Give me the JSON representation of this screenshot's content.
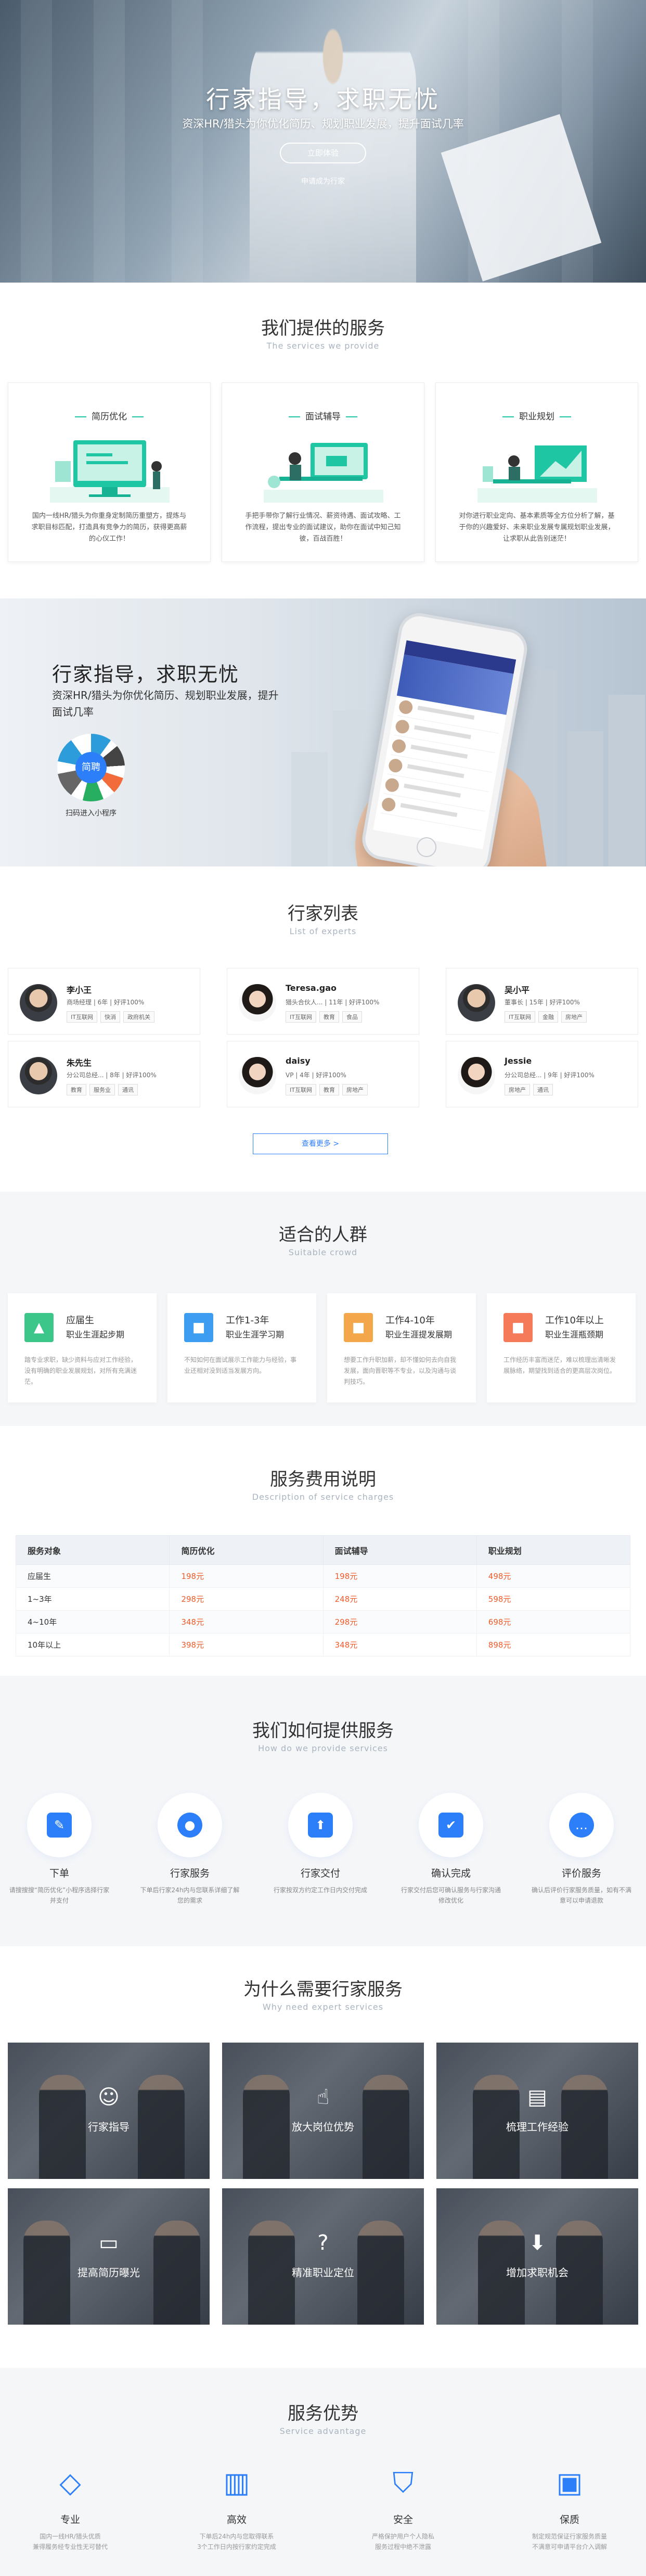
{
  "hero": {
    "title": "行家指导，求职无忧",
    "subtitle": "资深HR/猎头为你优化简历、规划职业发展，提升面试几率",
    "cta": "立即体验",
    "link": "申请成为行家"
  },
  "services": {
    "title": "我们提供的服务",
    "subtitle": "The services we provide",
    "items": [
      {
        "name": "简历优化",
        "desc": "国内一线HR/猎头为你重身定制简历重塑方，提炼与求职目标匹配，打造具有竞争力的简历，获得更高薪的心仪工作！",
        "icon": "resume-illustration"
      },
      {
        "name": "面试辅导",
        "desc": "手把手带你了解行业情况、薪资待遇、面试攻略、工作流程，提出专业的面试建议，助你在面试中知己知彼，百战百胜！",
        "icon": "interview-illustration"
      },
      {
        "name": "职业规划",
        "desc": "对你进行职业定向、基本素质等全方位分析了解，基于你的兴趣爱好、未来职业发展专属规划职业发展，让求职从此告别迷茫！",
        "icon": "career-illustration"
      }
    ]
  },
  "banner": {
    "title": "行家指导，求职无忧",
    "subtitle": "资深HR/猎头为你优化简历、规划职业发展，提升面试几率",
    "qr_center": "简聘",
    "qr_label": "扫码进入小程序"
  },
  "experts": {
    "title": "行家列表",
    "subtitle": "List of experts",
    "more": "查看更多 >",
    "items": [
      {
        "name": "李小王",
        "info": "商场经理 | 6年 | 好评100%",
        "tags": [
          "IT互联网",
          "快消",
          "政府机关"
        ],
        "gender": "m"
      },
      {
        "name": "Teresa.gao",
        "info": "猎头合伙人... | 11年 | 好评100%",
        "tags": [
          "IT互联网",
          "教育",
          "食品"
        ],
        "gender": "f"
      },
      {
        "name": "吴小平",
        "info": "董事长 | 15年 | 好评100%",
        "tags": [
          "IT互联网",
          "金融",
          "房地产"
        ],
        "gender": "m"
      },
      {
        "name": "朱先生",
        "info": "分公司总经... | 8年 | 好评100%",
        "tags": [
          "教育",
          "服务业",
          "通讯"
        ],
        "gender": "m"
      },
      {
        "name": "daisy",
        "info": "VP | 4年 | 好评100%",
        "tags": [
          "IT互联网",
          "教育",
          "房地产"
        ],
        "gender": "f"
      },
      {
        "name": "Jessie",
        "info": "分公司总经... | 9年 | 好评100%",
        "tags": [
          "房地产",
          "通讯"
        ],
        "gender": "f"
      }
    ]
  },
  "suitable": {
    "title": "适合的人群",
    "subtitle": "Suitable crowd",
    "items": [
      {
        "t1": "应届生",
        "t2": "职业生涯起步期",
        "desc": "踏专业求职，缺少资料与应对工作经验，没有明确的职业发展规划，对所有充满迷茫。",
        "color": "#3cc68a",
        "icon": "graduate-icon"
      },
      {
        "t1": "工作1-3年",
        "t2": "职业生涯学习期",
        "desc": "不知如何在面试展示工作能力与经验，事业还相对没到适当发展方向。",
        "color": "#3d9df0",
        "icon": "briefcase-icon"
      },
      {
        "t1": "工作4-10年",
        "t2": "职业生涯提发展期",
        "desc": "想要工作升职加薪，却不懂如何去向自我发展，面向晋职等不专业，以及沟通与谈判技巧。",
        "color": "#f4a74a",
        "icon": "briefcase-icon"
      },
      {
        "t1": "工作10年以上",
        "t2": "职业生涯瓶颈期",
        "desc": "工作经历丰富而迷茫，难以梳理出清晰发展脉络，期望找到适合的更高层次岗位。",
        "color": "#f57a5a",
        "icon": "briefcase-icon"
      }
    ]
  },
  "pricing": {
    "title": "服务费用说明",
    "subtitle": "Description of service charges",
    "headers": [
      "服务对象",
      "简历优化",
      "面试辅导",
      "职业规划"
    ],
    "rows": [
      [
        "应届生",
        "198元",
        "198元",
        "498元"
      ],
      [
        "1~3年",
        "298元",
        "248元",
        "598元"
      ],
      [
        "4~10年",
        "348元",
        "298元",
        "698元"
      ],
      [
        "10年以上",
        "398元",
        "348元",
        "898元"
      ]
    ]
  },
  "process": {
    "title": "我们如何提供服务",
    "subtitle": "How do we provide services",
    "items": [
      {
        "name": "下单",
        "desc": "请搜搜搜“简历优化”小程序选择行家并支付",
        "icon": "order-icon"
      },
      {
        "name": "行家服务",
        "desc": "下单后行家24h内与您联系详细了解您的需求",
        "icon": "user-icon"
      },
      {
        "name": "行家交付",
        "desc": "行家按双方约定工作日内交付完成",
        "icon": "upload-icon"
      },
      {
        "name": "确认完成",
        "desc": "行家交付后您可确认服务与行家沟通修改优化",
        "icon": "check-icon"
      },
      {
        "name": "评价服务",
        "desc": "确认后评价行家服务质量，如有不满意可以申请退款",
        "icon": "chat-icon"
      }
    ]
  },
  "why": {
    "title": "为什么需要行家服务",
    "subtitle": "Why need expert services",
    "items": [
      {
        "text": "行家指导",
        "icon": "user-icon"
      },
      {
        "text": "放大岗位优势",
        "icon": "thumb-icon"
      },
      {
        "text": "梳理工作经验",
        "icon": "document-icon"
      },
      {
        "text": "提高简历曝光",
        "icon": "monitor-icon"
      },
      {
        "text": "精准职业定位",
        "icon": "question-icon"
      },
      {
        "text": "增加求职机会",
        "icon": "download-icon"
      }
    ]
  },
  "advantage": {
    "title": "服务优势",
    "subtitle": "Service advantage",
    "items": [
      {
        "name": "专业",
        "desc": "国内一线HR/猎头优质\n兼得履务经专业性无可替代",
        "icon": "diamond-icon"
      },
      {
        "name": "高效",
        "desc": "下单后24h内与您取得联系\n3个工作日内按行家约定完成",
        "icon": "chart-icon"
      },
      {
        "name": "安全",
        "desc": "严格保护用户个人隐私\n服务过程中绝不泄露",
        "icon": "shield-icon"
      },
      {
        "name": "保质",
        "desc": "制定规范保证行家服务质量\n不满意可申请平台介入调解",
        "icon": "doc-check-icon"
      }
    ]
  }
}
